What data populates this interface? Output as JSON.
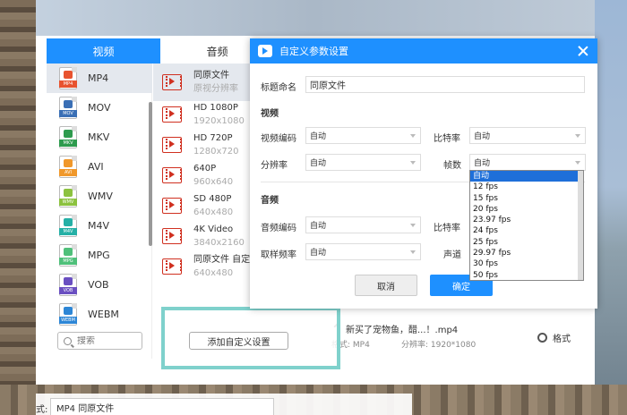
{
  "tabs": [
    {
      "label": "视频",
      "active": true
    },
    {
      "label": "音频",
      "active": false
    }
  ],
  "formats": [
    {
      "label": "MP4",
      "badge": "MP4",
      "color": "#e8532f",
      "selected": true
    },
    {
      "label": "MOV",
      "badge": "MOV",
      "color": "#3a6fb5",
      "selected": false
    },
    {
      "label": "MKV",
      "badge": "MKV",
      "color": "#2e9b4e",
      "selected": false
    },
    {
      "label": "AVI",
      "badge": "AVI",
      "color": "#f0982b",
      "selected": false
    },
    {
      "label": "WMV",
      "badge": "WMV",
      "color": "#8cc23f",
      "selected": false
    },
    {
      "label": "M4V",
      "badge": "M4V",
      "color": "#25b0a6",
      "selected": false
    },
    {
      "label": "MPG",
      "badge": "MPG",
      "color": "#4fc07a",
      "selected": false
    },
    {
      "label": "VOB",
      "badge": "VOB",
      "color": "#6a4fc1",
      "selected": false
    },
    {
      "label": "WEBM",
      "badge": "WEBM",
      "color": "#2d86d6",
      "selected": false
    }
  ],
  "search": {
    "placeholder": "搜索"
  },
  "presets": [
    {
      "name": "同原文件",
      "sub": "原视分辨率",
      "selected": true
    },
    {
      "name": "HD 1080P",
      "sub": "1920x1080",
      "selected": false
    },
    {
      "name": "HD 720P",
      "sub": "1280x720",
      "selected": false
    },
    {
      "name": "640P",
      "sub": "960x640",
      "selected": false
    },
    {
      "name": "SD 480P",
      "sub": "640x480",
      "selected": false
    },
    {
      "name": "4K Video",
      "sub": "3840x2160",
      "selected": false
    },
    {
      "name": "同原文件 自定义",
      "sub": "640x480",
      "selected": false
    }
  ],
  "add_custom_label": "添加自定义设置",
  "file": {
    "name": "新买了宠物鱼，醋...！.mp4",
    "format_meta": "格式: MP4",
    "resolution_meta": "分辨率: 1920*1080",
    "format_button": "格式"
  },
  "bottom": {
    "label": "式:",
    "value": "MP4  同原文件"
  },
  "dialog": {
    "title": "自定义参数设置",
    "title_label": "标题命名",
    "title_value": "同原文件",
    "video_section": "视频",
    "video_codec_label": "视频编码",
    "video_codec_value": "自动",
    "bitrate_label": "比特率",
    "bitrate_value": "自动",
    "resolution_label": "分辨率",
    "resolution_value": "自动",
    "fps_label": "帧数",
    "fps_value": "自动",
    "audio_section": "音频",
    "audio_codec_label": "音频编码",
    "audio_codec_value": "自动",
    "audio_bitrate_label": "比特率",
    "sample_rate_label": "取样频率",
    "sample_rate_value": "自动",
    "channel_label": "声道",
    "cancel": "取消",
    "ok": "确定"
  },
  "fps_options": [
    {
      "label": "自动",
      "selected": true
    },
    {
      "label": "12 fps",
      "selected": false
    },
    {
      "label": "15 fps",
      "selected": false
    },
    {
      "label": "20 fps",
      "selected": false
    },
    {
      "label": "23.97 fps",
      "selected": false
    },
    {
      "label": "24 fps",
      "selected": false
    },
    {
      "label": "25 fps",
      "selected": false
    },
    {
      "label": "29.97 fps",
      "selected": false
    },
    {
      "label": "30 fps",
      "selected": false
    },
    {
      "label": "50 fps",
      "selected": false
    }
  ]
}
